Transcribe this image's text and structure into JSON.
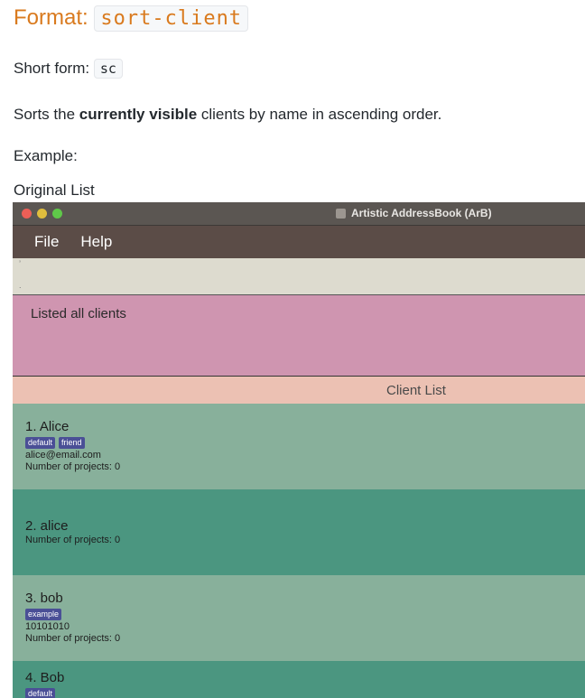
{
  "doc": {
    "format_label": "Format:",
    "format_code": "sort-client",
    "short_label": "Short form:",
    "short_code": "sc",
    "desc_prefix": "Sorts the ",
    "desc_bold": "currently visible",
    "desc_suffix": " clients by name in ascending order.",
    "example": "Example:",
    "original_list": "Original List"
  },
  "window": {
    "title": "Artistic AddressBook (ArB)",
    "menu": [
      "File",
      "Help"
    ],
    "command_box_marks": [
      "’",
      "."
    ],
    "result_text": "Listed all clients",
    "list_header": "Client List"
  },
  "clients": [
    {
      "name": "1.  Alice",
      "tags": [
        "default",
        "friend"
      ],
      "lines": [
        "alice@email.com",
        "Number of projects: 0"
      ]
    },
    {
      "name": "2.  alice",
      "tags": [],
      "lines": [
        "Number of projects: 0"
      ]
    },
    {
      "name": "3.  bob",
      "tags": [
        "example"
      ],
      "lines": [
        "10101010",
        "Number of projects: 0"
      ]
    },
    {
      "name": "4.  Bob",
      "tags": [
        "default"
      ],
      "lines": []
    }
  ],
  "colors": {
    "heading_accent": "#d97a1e",
    "titlebar": "#5b5652",
    "menubar": "#5b4c47",
    "command_box": "#dddbcf",
    "result_box": "#cf95b0",
    "list_header": "#ecc1b3",
    "card_light": "#88b09b",
    "card_dark": "#4b9680",
    "tag": "#4a4f96"
  }
}
